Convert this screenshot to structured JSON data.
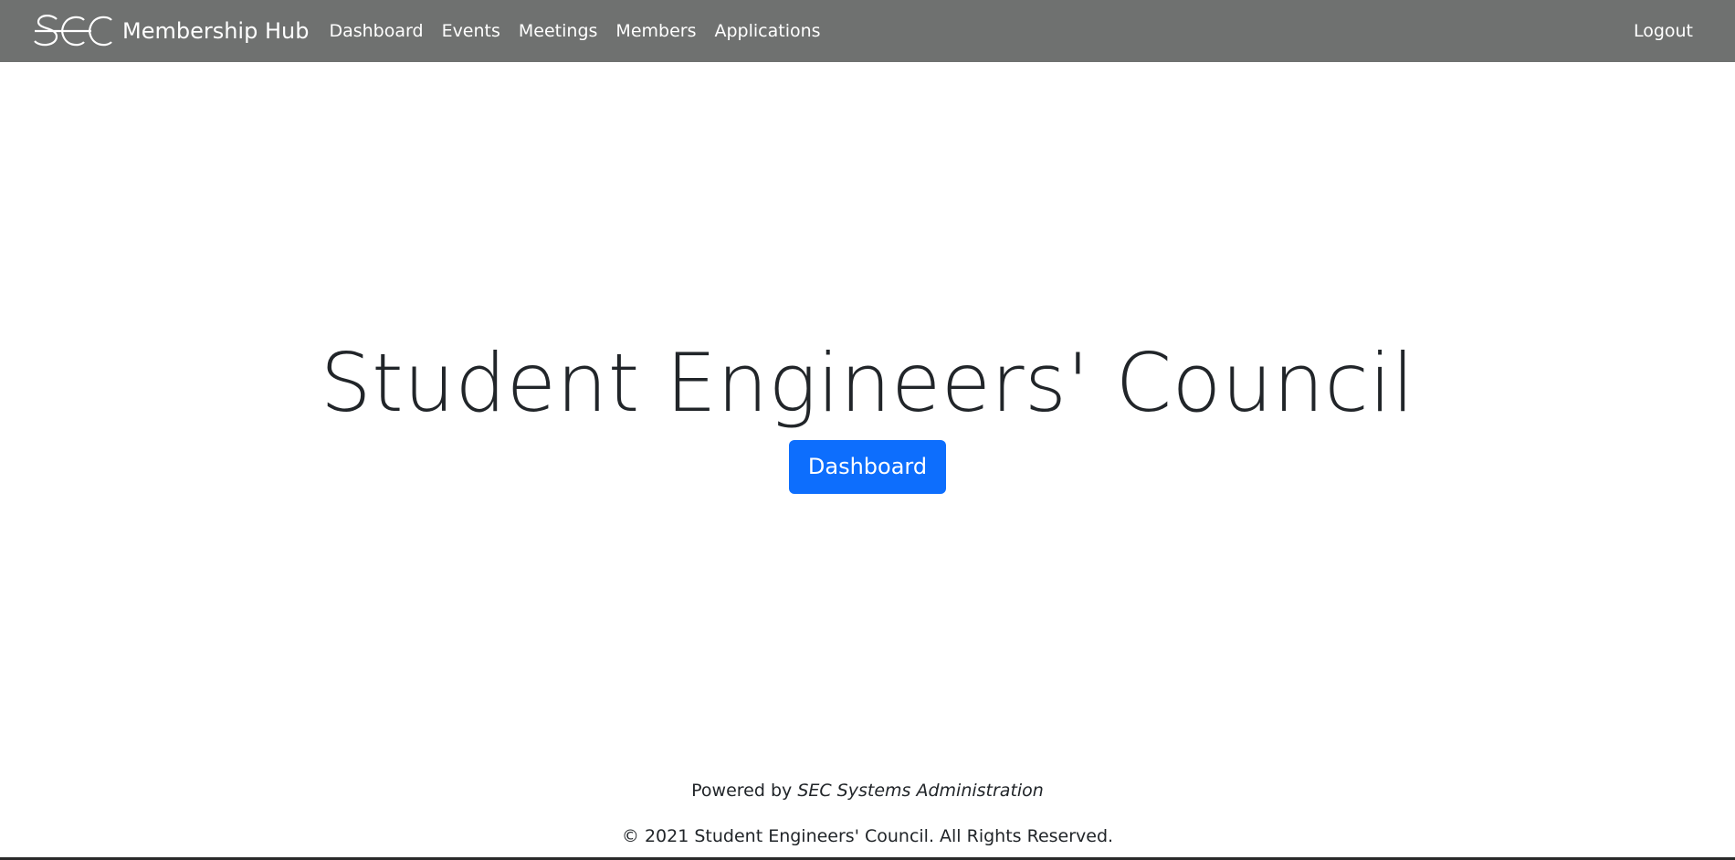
{
  "navbar": {
    "brand_text": "Membership Hub",
    "logo_icon": "sec-logo-icon",
    "links": [
      {
        "label": "Dashboard"
      },
      {
        "label": "Events"
      },
      {
        "label": "Meetings"
      },
      {
        "label": "Members"
      },
      {
        "label": "Applications"
      }
    ],
    "logout_label": "Logout",
    "background_color": "#6f7170"
  },
  "hero": {
    "title": "Student Engineers' Council",
    "button_label": "Dashboard",
    "button_color": "#0d6efd"
  },
  "footer": {
    "powered_prefix": "Powered by",
    "powered_by": "SEC Systems Administration",
    "copyright": "© 2021 Student Engineers' Council. All Rights Reserved."
  }
}
